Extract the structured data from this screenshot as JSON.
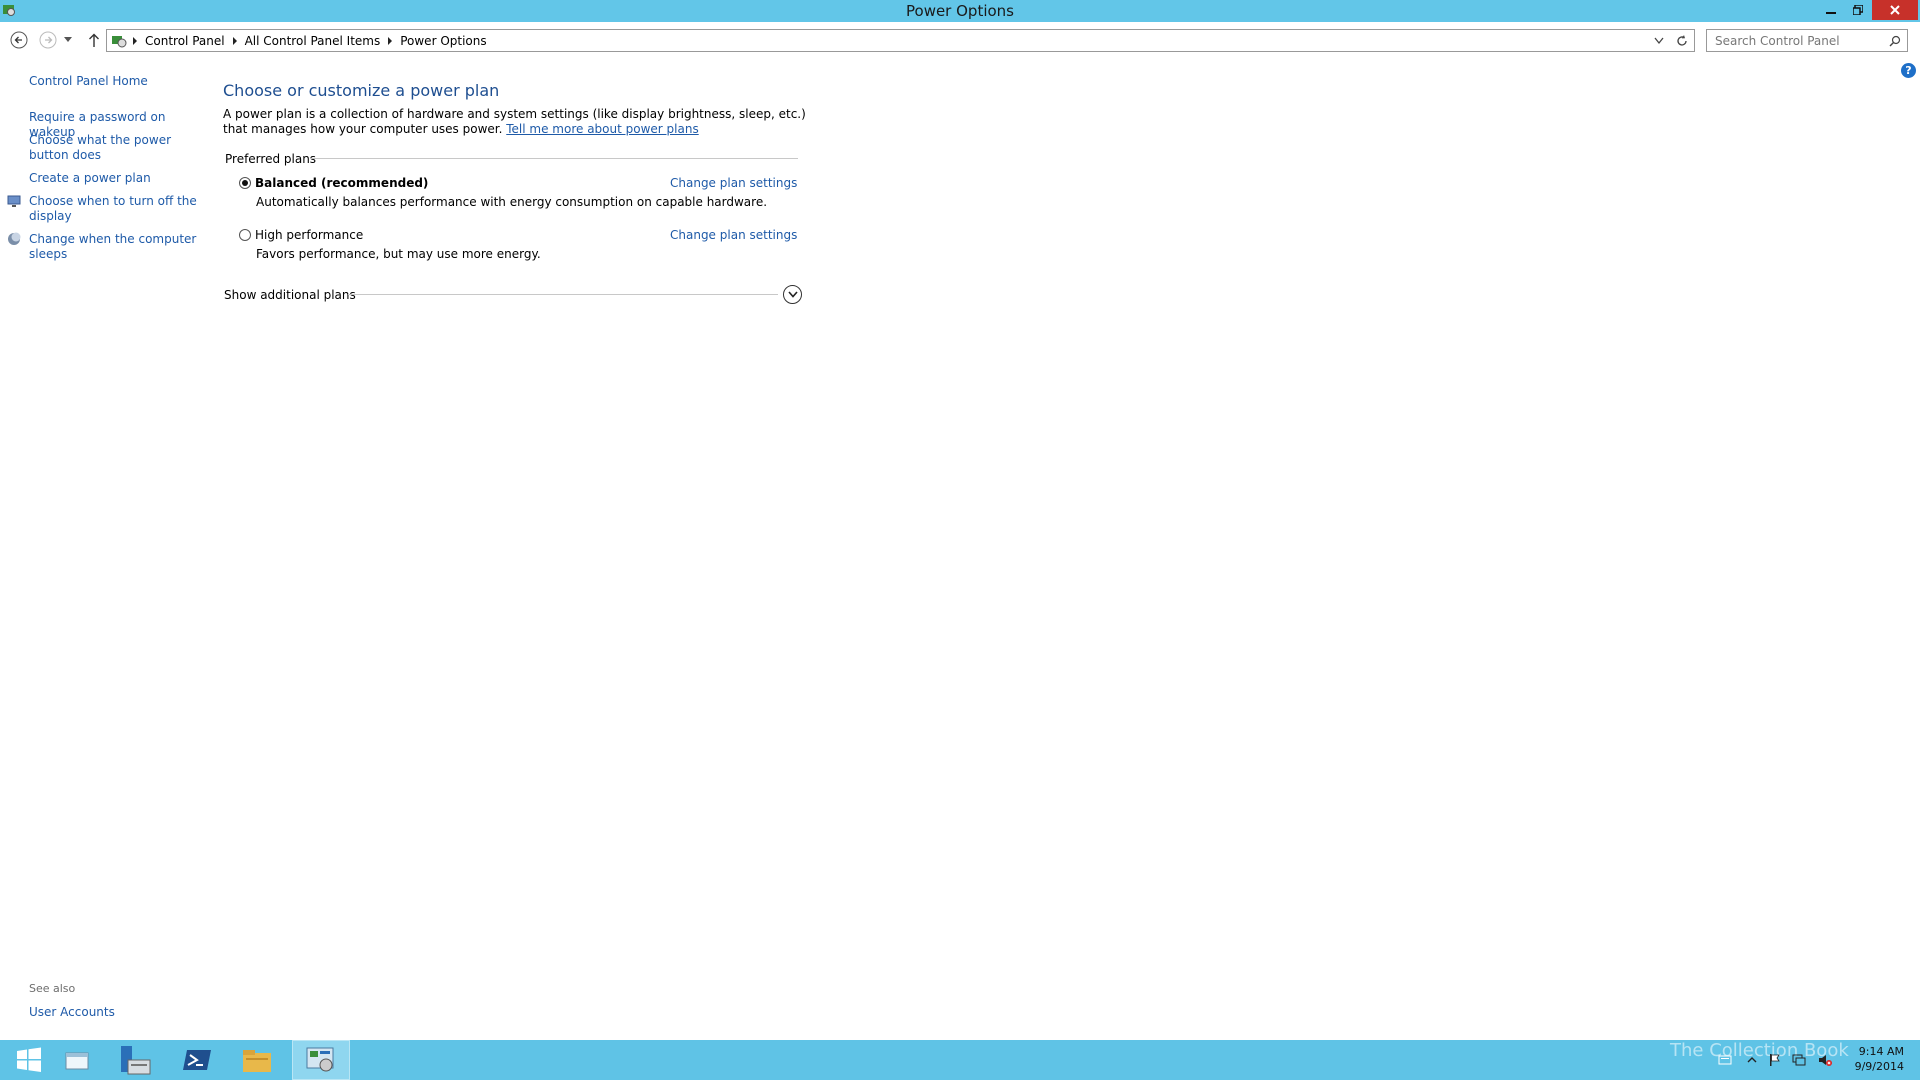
{
  "window": {
    "title": "Power Options",
    "controls": {
      "minimize": "minimize",
      "maximize": "restore",
      "close": "close"
    }
  },
  "address_bar": {
    "breadcrumbs": [
      "Control Panel",
      "All Control Panel Items",
      "Power Options"
    ],
    "search_placeholder": "Search Control Panel"
  },
  "sidebar": {
    "home": "Control Panel Home",
    "items": [
      {
        "label": "Require a password on wakeup",
        "icon": ""
      },
      {
        "label": "Choose what the power button does",
        "icon": ""
      },
      {
        "label": "Create a power plan",
        "icon": ""
      },
      {
        "label": "Choose when to turn off the display",
        "icon": "monitor-icon"
      },
      {
        "label": "Change when the computer sleeps",
        "icon": "moon-icon"
      }
    ],
    "see_also_label": "See also",
    "see_also_links": [
      "User Accounts"
    ]
  },
  "main": {
    "heading": "Choose or customize a power plan",
    "description": "A power plan is a collection of hardware and system settings (like display brightness, sleep, etc.) that manages how your computer uses power.",
    "learn_more_link": "Tell me more about power plans",
    "preferred_plans_label": "Preferred plans",
    "plans": [
      {
        "name": "Balanced (recommended)",
        "description": "Automatically balances performance with energy consumption on capable hardware.",
        "selected": true,
        "link": "Change plan settings"
      },
      {
        "name": "High performance",
        "description": "Favors performance, but may use more energy.",
        "selected": false,
        "link": "Change plan settings"
      }
    ],
    "show_additional_plans": "Show additional plans"
  },
  "taskbar": {
    "items": [
      "start",
      "explorer-window",
      "server-manager",
      "powershell",
      "file-explorer",
      "control-panel"
    ],
    "active_item": "control-panel",
    "clock_time": "9:14 AM",
    "clock_date": "9/9/2014",
    "watermark": "The Collection Book"
  },
  "colors": {
    "titlebar": "#62c6e8",
    "taskbar": "#5fc3e6",
    "link": "#1e5aa8",
    "heading": "#1e4e90",
    "close_button": "#c7312a"
  }
}
